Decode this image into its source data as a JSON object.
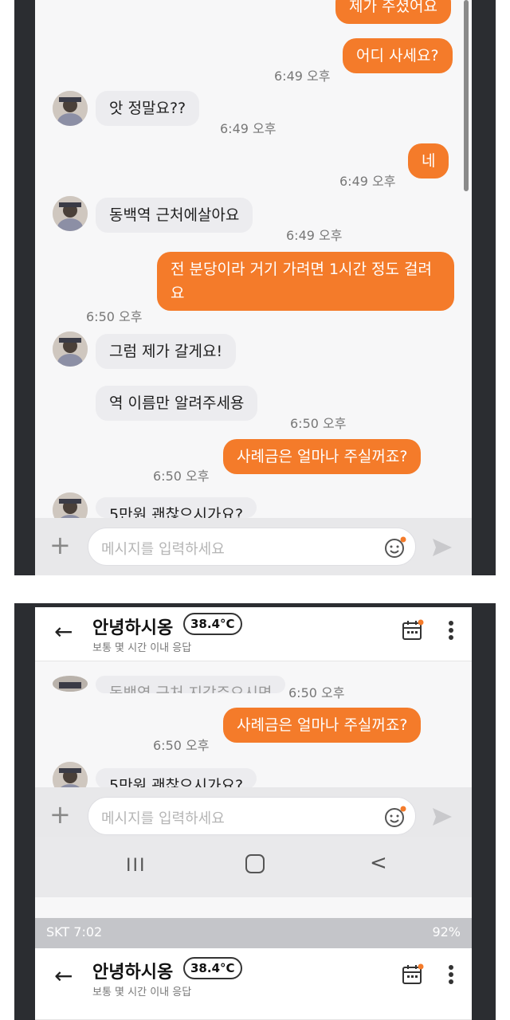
{
  "colors": {
    "my_bubble": "#f47b2a",
    "their_bubble": "#ececef",
    "timestamp": "#777777"
  },
  "icons": [
    "plus-icon",
    "emoji-icon",
    "send-icon",
    "back-arrow-icon",
    "calendar-icon",
    "more-vertical-icon",
    "recent-apps-icon",
    "home-icon",
    "nav-back-icon"
  ],
  "screen1": {
    "messages": [
      {
        "from": "me",
        "text": "제가 주셨어요"
      },
      {
        "from": "me",
        "text": "어디 사세요?",
        "time": "6:49 오후"
      },
      {
        "from": "other",
        "text": "앗 정말요??",
        "time": "6:49 오후"
      },
      {
        "from": "me",
        "text": "네",
        "time": "6:49 오후"
      },
      {
        "from": "other",
        "text": "동백역 근처에살아요",
        "time": "6:49 오후"
      },
      {
        "from": "me",
        "text": "전 분당이라 거기 가려면 1시간 정도 걸려요",
        "time": "6:50 오후"
      },
      {
        "from": "other",
        "text": "그럼 제가 갈게요!"
      },
      {
        "from": "other",
        "text": "역 이름만 알려주세용",
        "time": "6:50 오후"
      },
      {
        "from": "me",
        "text": "사례금은 얼마나 주실꺼죠?",
        "time": "6:50 오후"
      },
      {
        "from": "other",
        "text": "5만원 괜찮으시가요?"
      }
    ],
    "composer": {
      "placeholder": "메시지를 입력하세요"
    }
  },
  "screen2": {
    "header": {
      "name": "안녕하시옹",
      "temperature": "38.4°C",
      "response": "보통 몇 시간 이내 응답"
    },
    "messages": [
      {
        "from": "other",
        "text": "동백역 근처 지각주으시면",
        "time": "6:50 오후"
      },
      {
        "from": "me",
        "text": "사례금은 얼마나 주실꺼죠?",
        "time": "6:50 오후"
      },
      {
        "from": "other",
        "text": "5만원 괜찮으시가요?"
      }
    ],
    "composer": {
      "placeholder": "메시지를 입력하세요"
    },
    "navbar": {
      "recent": "III",
      "back": "<"
    },
    "status_bar": {
      "carrier_time": "SKT 7:02",
      "battery": "92%"
    },
    "header2": {
      "name": "안녕하시옹",
      "temperature": "38.4°C",
      "response": "보통 몇 시간 이내 응답"
    }
  }
}
